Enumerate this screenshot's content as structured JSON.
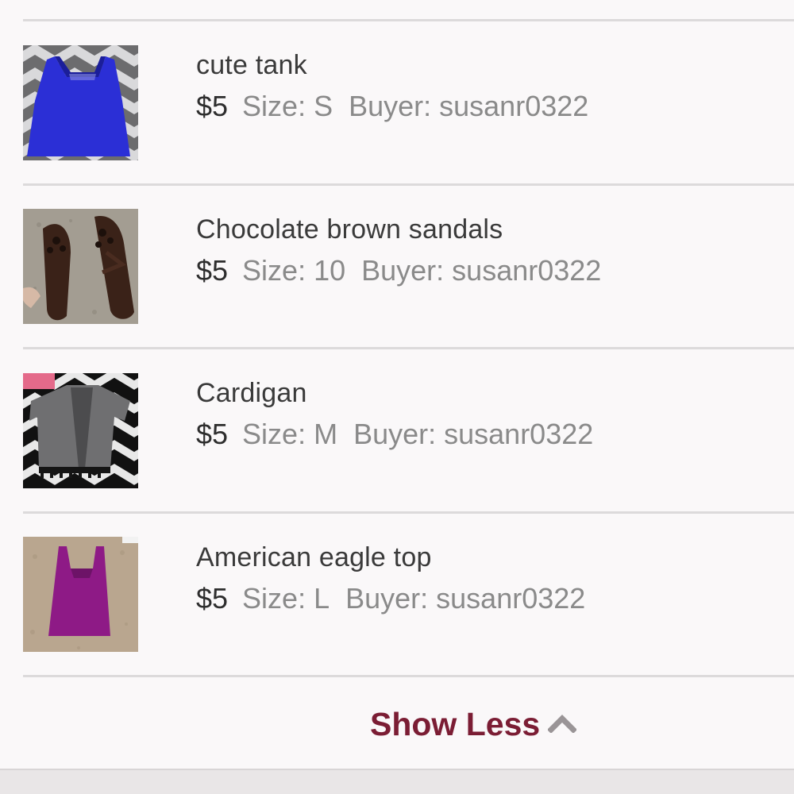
{
  "items": [
    {
      "title": "cute tank",
      "price": "$5",
      "size": "Size: S",
      "buyer": "Buyer: susanr0322",
      "image_icon": "blue-tank-top-photo"
    },
    {
      "title": "Chocolate brown sandals",
      "price": "$5",
      "size": "Size: 10",
      "buyer": "Buyer: susanr0322",
      "image_icon": "brown-sandals-photo"
    },
    {
      "title": "Cardigan",
      "price": "$5",
      "size": "Size: M",
      "buyer": "Buyer: susanr0322",
      "image_icon": "gray-cardigan-photo"
    },
    {
      "title": "American eagle top",
      "price": "$5",
      "size": "Size: L",
      "buyer": "Buyer: susanr0322",
      "image_icon": "purple-tank-photo"
    }
  ],
  "show_less": {
    "label": "Show Less",
    "icon": "chevron-up-icon"
  },
  "colors": {
    "accent": "#7b1d34",
    "divider": "#dcdadb",
    "background": "#faf8f9",
    "title_text": "#3a3a3a",
    "meta_text": "#8a8a8a",
    "chevron": "#9a9597"
  }
}
